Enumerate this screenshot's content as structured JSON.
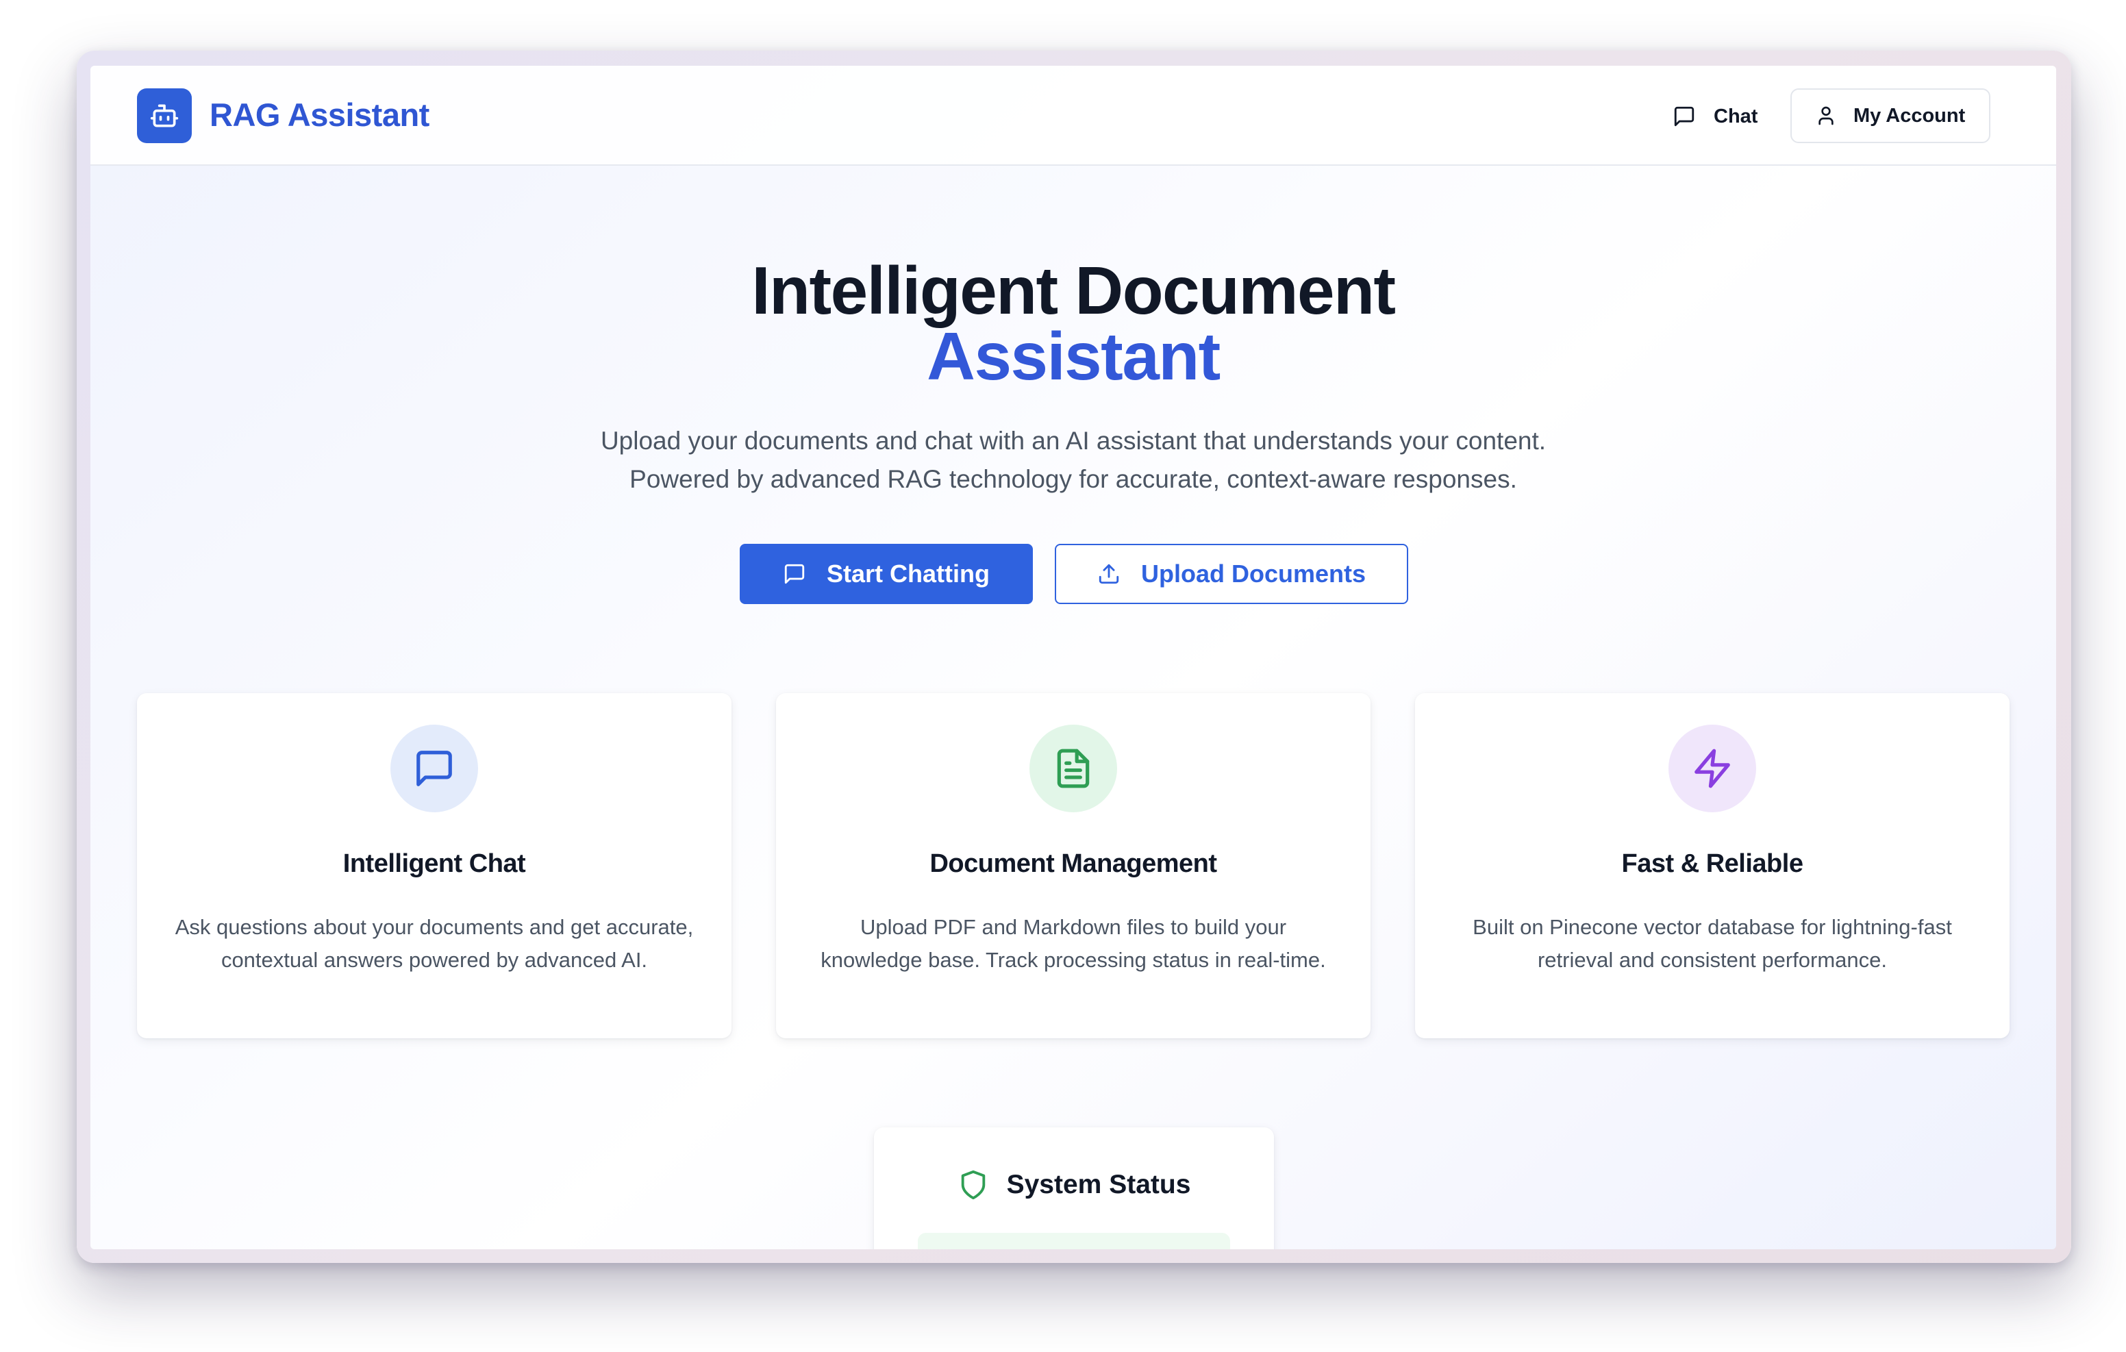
{
  "app": {
    "brand_name": "RAG Assistant",
    "brand_icon": "bot-icon",
    "accent_color": "#2f62df"
  },
  "nav": {
    "chat_label": "Chat",
    "chat_icon": "message-square-icon",
    "account_label": "My Account",
    "account_icon": "user-icon"
  },
  "hero": {
    "title_line1": "Intelligent Document",
    "title_line2": "Assistant",
    "subtitle_line1": "Upload your documents and chat with an AI assistant that understands your content.",
    "subtitle_line2": "Powered by advanced RAG technology for accurate, context-aware responses.",
    "primary_button": "Start Chatting",
    "primary_icon": "message-square-icon",
    "secondary_button": "Upload Documents",
    "secondary_icon": "upload-icon"
  },
  "features": [
    {
      "icon": "message-square-icon",
      "icon_color": "#2f5fd8",
      "icon_bg": "#e3ebfb",
      "title": "Intelligent Chat",
      "description": "Ask questions about your documents and get accurate, contextual answers powered by advanced AI."
    },
    {
      "icon": "file-text-icon",
      "icon_color": "#2f9e54",
      "icon_bg": "#e2f6e8",
      "title": "Document Management",
      "description": "Upload PDF and Markdown files to build your knowledge base. Track processing status in real-time."
    },
    {
      "icon": "zap-icon",
      "icon_color": "#8a3fe0",
      "icon_bg": "#f0e6fb",
      "title": "Fast & Reliable",
      "description": "Built on Pinecone vector database for lightning-fast retrieval and consistent performance."
    }
  ],
  "status": {
    "title": "System Status",
    "icon": "shield-icon",
    "icon_color": "#2f9e54"
  }
}
